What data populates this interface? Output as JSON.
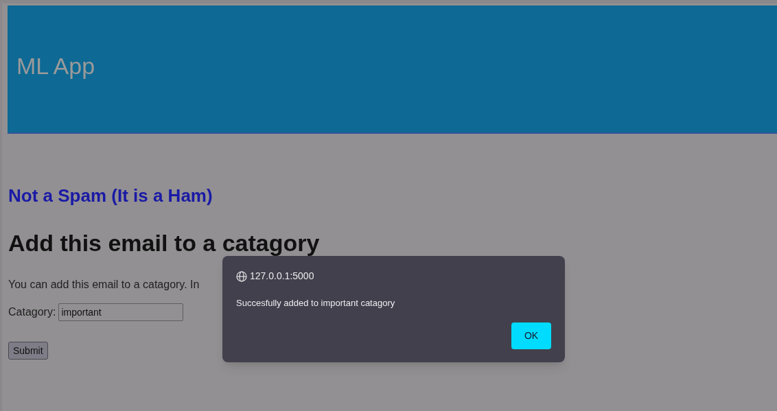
{
  "header": {
    "title": "ML App"
  },
  "result": "Not a Spam (It is a Ham)",
  "section": {
    "heading": "Add this email to a catagory",
    "text": "You can add this email to a catagory. In",
    "field_label": "Catagory:",
    "field_value": "important",
    "submit": "Submit"
  },
  "dialog": {
    "origin": "127.0.0.1:5000",
    "message": "Succesfully added to important catagory",
    "ok": "OK"
  }
}
